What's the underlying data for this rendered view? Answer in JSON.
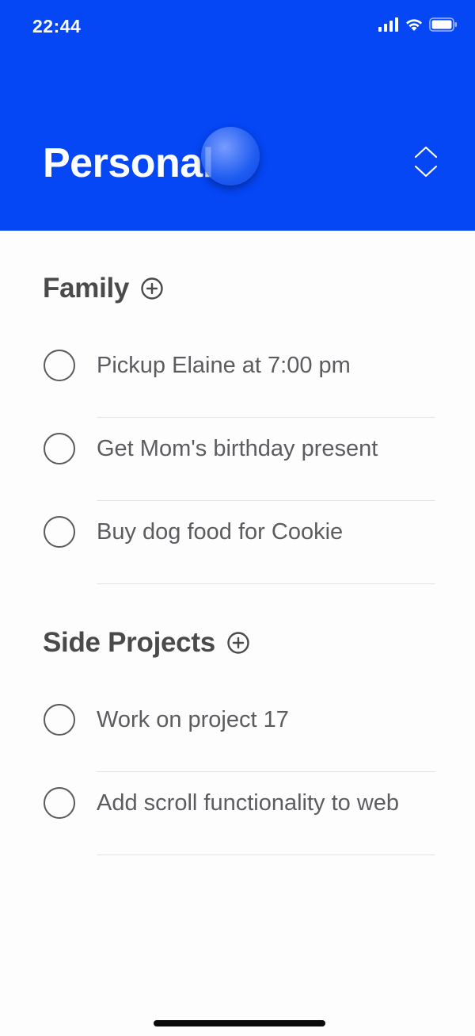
{
  "status_bar": {
    "time": "22:44"
  },
  "header": {
    "title": "Personal",
    "background": "#0546f5"
  },
  "sections": [
    {
      "title": "Family",
      "tasks": [
        {
          "label": "Pickup Elaine at 7:00 pm",
          "done": false
        },
        {
          "label": "Get Mom's birthday present",
          "done": false
        },
        {
          "label": "Buy dog food for Cookie",
          "done": false
        }
      ]
    },
    {
      "title": "Side Projects",
      "tasks": [
        {
          "label": "Work on project 17",
          "done": false
        },
        {
          "label": "Add scroll functionality to web",
          "done": false
        }
      ]
    }
  ],
  "icons": {
    "section_add": "plus-circle-icon",
    "sort_toggle": "chevron-up-down-icon",
    "task_checkbox": "empty-circle-icon"
  }
}
